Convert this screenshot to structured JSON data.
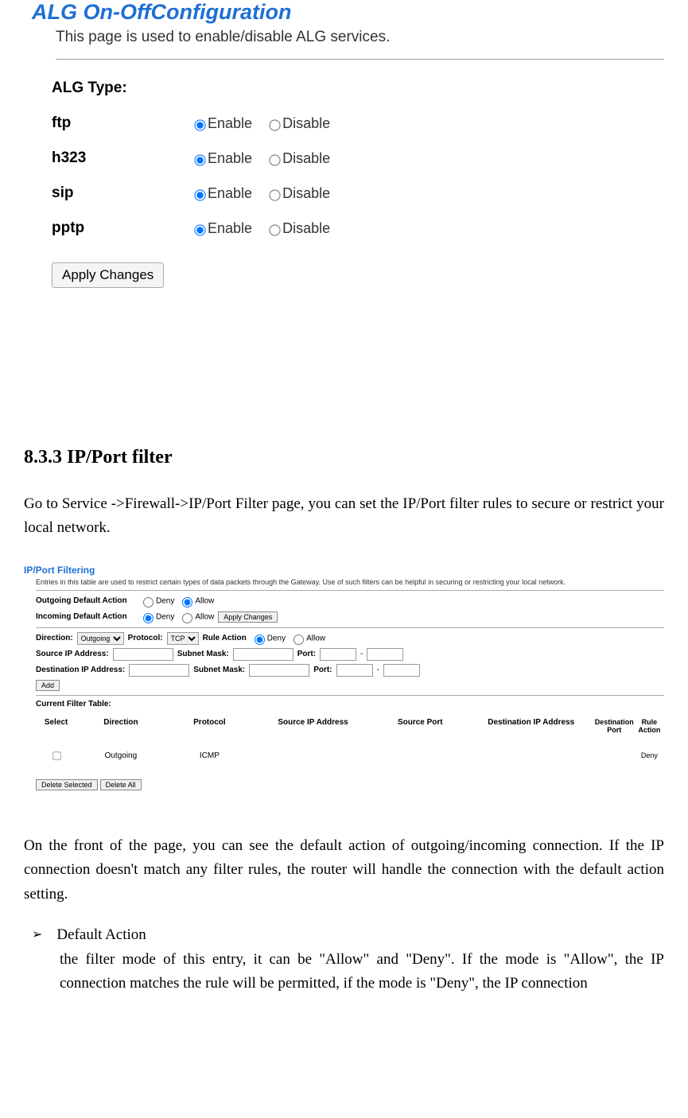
{
  "alg": {
    "title": "ALG On-OffConfiguration",
    "description": "This page is used to enable/disable ALG services.",
    "type_label": "ALG Type:",
    "enable_label": "Enable",
    "disable_label": "Disable",
    "rows": {
      "ftp": "ftp",
      "h323": "h323",
      "sip": "sip",
      "pptp": "pptp"
    },
    "apply_button": "Apply Changes"
  },
  "section": {
    "heading": "8.3.3 IP/Port filter",
    "intro": "Go to Service ->Firewall->IP/Port Filter page, you can set the IP/Port filter rules to secure or restrict your local network."
  },
  "filter": {
    "title": "IP/Port Filtering",
    "description": "Entries in this table are used to restrict certain types of data packets through the Gateway. Use of such filters can be helpful in securing or restricting your local network.",
    "outgoing_label": "Outgoing Default Action",
    "incoming_label": "Incoming Default Action",
    "deny_label": "Deny",
    "allow_label": "Allow",
    "apply_button": "Apply Changes",
    "direction_label": "Direction:",
    "direction_value": "Outgoing",
    "protocol_label": "Protocol:",
    "protocol_value": "TCP",
    "rule_action_label": "Rule Action",
    "src_ip_label": "Source IP Address:",
    "subnet_label": "Subnet Mask:",
    "port_label": "Port:",
    "dest_ip_label": "Destination IP Address:",
    "add_button": "Add",
    "current_table_label": "Current Filter Table:",
    "headers": {
      "select": "Select",
      "direction": "Direction",
      "protocol": "Protocol",
      "src_ip": "Source IP Address",
      "src_port": "Source Port",
      "dest_ip": "Destination IP Address",
      "dest_port": "Destination Port",
      "rule_action": "Rule Action"
    },
    "row": {
      "direction": "Outgoing",
      "protocol": "ICMP",
      "action": "Deny"
    },
    "delete_selected": "Delete Selected",
    "delete_all": "Delete All"
  },
  "post_text": "On the front of the page, you can see the default action of outgoing/incoming connection. If the IP connection doesn't match any filter rules, the router will handle the connection with the default action setting.",
  "bullet": {
    "heading": "Default Action",
    "body": "the filter mode of this entry, it can be \"Allow\" and \"Deny\". If the mode is \"Allow\", the IP connection matches the rule will be permitted, if the mode is \"Deny\", the IP connection"
  }
}
